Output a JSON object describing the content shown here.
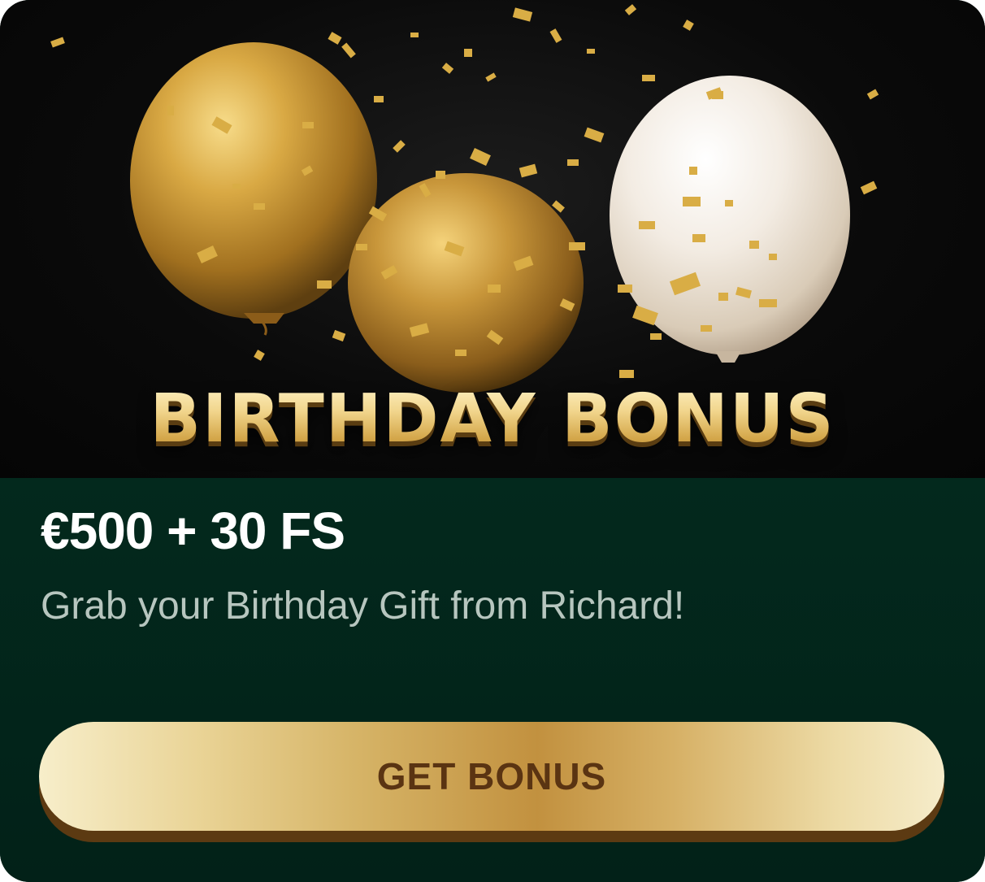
{
  "banner": {
    "title": "BIRTHDAY BONUS",
    "image": "balloons-and-confetti",
    "colors": {
      "gold": "#d6a640",
      "pearl": "#f2e8dc",
      "background": "#0a0a0a"
    }
  },
  "offer": {
    "amount": "€500 + 30 FS",
    "description": "Grab your Birthday Gift from Richard!"
  },
  "cta": {
    "label": "GET BONUS"
  },
  "colors": {
    "panel": "#03291d",
    "button_text": "#5a3412",
    "subtitle": "#b7c6bf"
  }
}
